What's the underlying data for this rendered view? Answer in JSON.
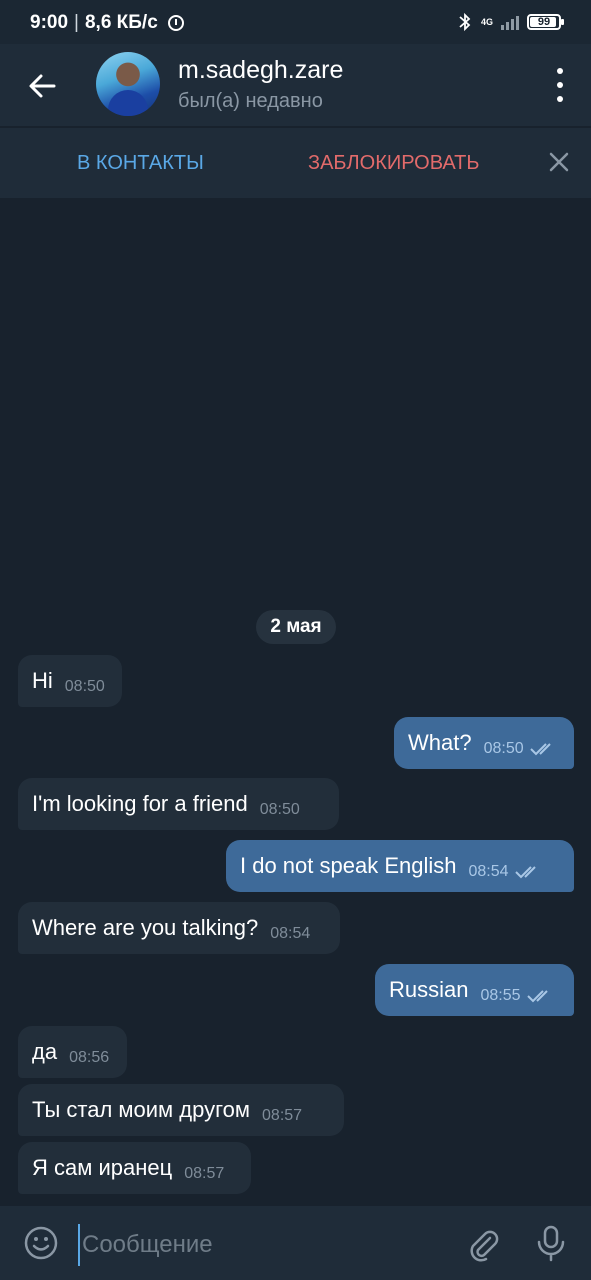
{
  "status_bar": {
    "time": "9:00",
    "separator": "|",
    "speed": "8,6 КБ/с",
    "network": "4G",
    "battery": "99",
    "icons": [
      "alarm-icon",
      "bluetooth-icon",
      "signal-icon",
      "battery-icon"
    ]
  },
  "header": {
    "contact_name": "m.sadegh.zare",
    "last_seen": "был(а) недавно",
    "icons": [
      "back-arrow-icon",
      "more-vertical-icon"
    ]
  },
  "action_bar": {
    "add_contact": "В КОНТАКТЫ",
    "block": "ЗАБЛОКИРОВАТЬ",
    "close_icon": "close-icon"
  },
  "chat": {
    "date": "2 мая",
    "messages": [
      {
        "direction": "in",
        "text": "Hi",
        "time": "08:50"
      },
      {
        "direction": "out",
        "text": "What?",
        "time": "08:50",
        "read": true
      },
      {
        "direction": "in",
        "text": "I'm looking for a friend",
        "time": "08:50"
      },
      {
        "direction": "out",
        "text": "I do not speak English",
        "time": "08:54",
        "read": true
      },
      {
        "direction": "in",
        "text": "Where are you talking?",
        "time": "08:54"
      },
      {
        "direction": "out",
        "text": "Russian",
        "time": "08:55",
        "read": true
      },
      {
        "direction": "in",
        "text": "да",
        "time": "08:56"
      },
      {
        "direction": "in",
        "text": "Ты стал моим другом",
        "time": "08:57"
      },
      {
        "direction": "in",
        "text": "Я сам иранец",
        "time": "08:57"
      }
    ]
  },
  "input_bar": {
    "placeholder": "Сообщение",
    "value": "",
    "icons": [
      "emoji-icon",
      "attach-icon",
      "microphone-icon"
    ]
  },
  "colors": {
    "background": "#18222d",
    "header": "#1f2c39",
    "incoming_bubble": "#222e3a",
    "outgoing_bubble": "#3e6a99",
    "accent_blue": "#5aa8e6",
    "danger_red": "#e26b6b"
  }
}
